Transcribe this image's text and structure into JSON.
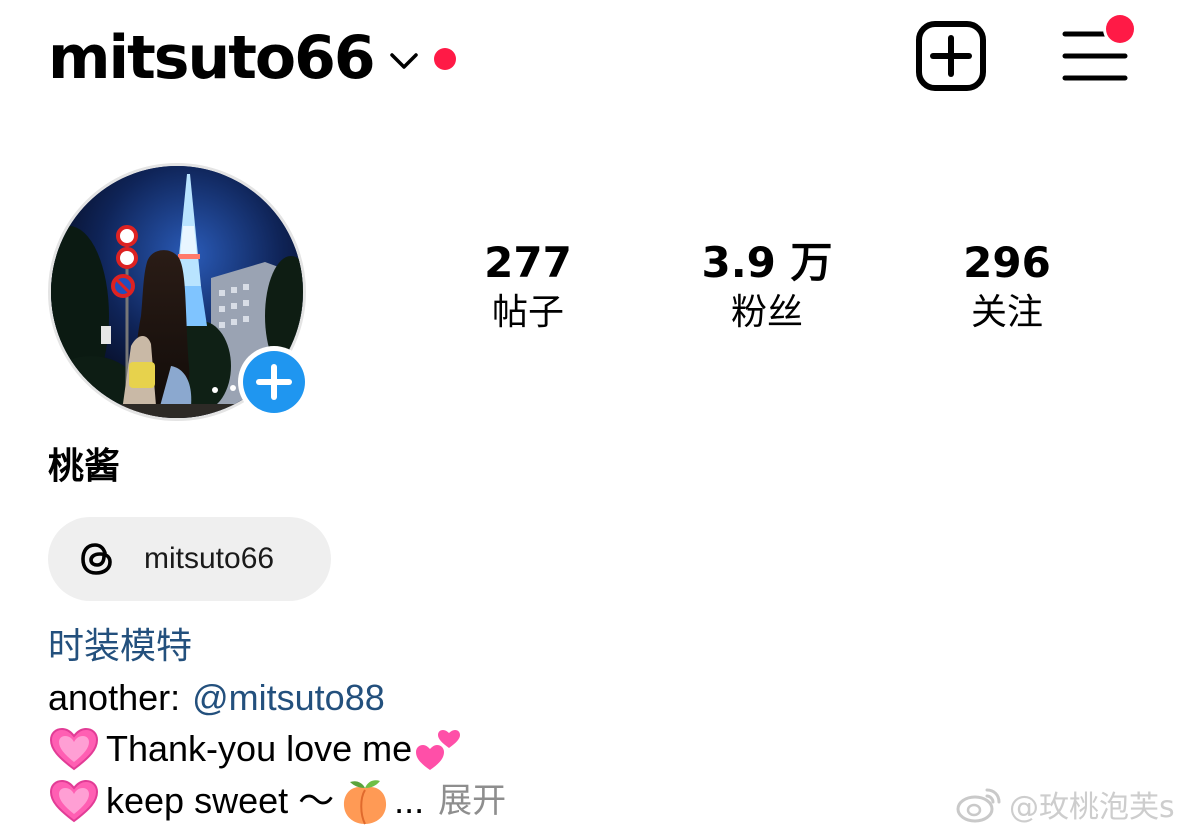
{
  "header": {
    "username": "mitsuto66",
    "dropdown_icon": "chevron-down-icon",
    "notification_dot_color": "#ff1a46",
    "new_post_icon": "plus-square-icon",
    "menu_icon": "hamburger-menu-icon"
  },
  "profile": {
    "avatar_icon": "avatar-photo",
    "add_story_icon": "plus-circle-icon",
    "stats": [
      {
        "value": "277",
        "label": "帖子"
      },
      {
        "value": "3.9 万",
        "label": "粉丝"
      },
      {
        "value": "296",
        "label": "关注"
      }
    ],
    "display_name": "桃酱",
    "threads": {
      "icon": "threads-icon",
      "handle": "mitsuto66"
    },
    "category": "时装模特",
    "bio": {
      "line1_prefix": "another:",
      "line1_mention": "@mitsuto88",
      "line2_text": "Thank-you love me",
      "line3_text": "keep sweet ～",
      "ellipsis": "...",
      "more_label": "展开"
    }
  },
  "watermark": {
    "icon": "weibo-icon",
    "text": "@玫桃泡芙s"
  },
  "colors": {
    "link": "#23507d",
    "chip_background": "#efefef",
    "badge": "#ff1a46",
    "add_story_blue": "#1f96f0",
    "muted": "#8e8e8e"
  }
}
